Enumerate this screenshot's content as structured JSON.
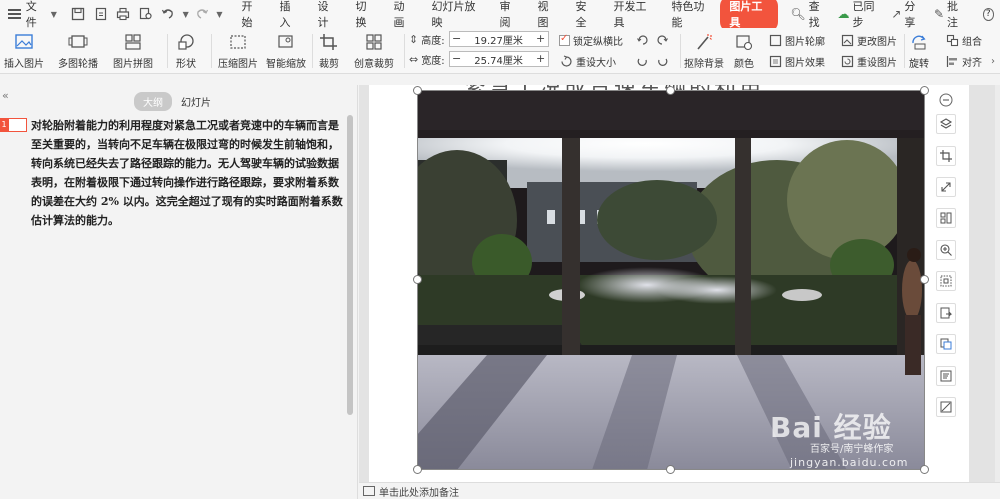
{
  "menubar": {
    "file": "文件",
    "tabs": [
      "开始",
      "插入",
      "设计",
      "切换",
      "动画",
      "幻灯片放映",
      "审阅",
      "视图",
      "安全",
      "开发工具",
      "特色功能"
    ],
    "active_tab": "图片工具",
    "search": "查找",
    "sync": "已同步",
    "share": "分享",
    "comment": "批注",
    "help": "?"
  },
  "ribbon": {
    "insert_picture": "插入图片",
    "multi_carousel": "多图轮播",
    "picture_collage": "图片拼图",
    "shape": "形状",
    "compress": "压缩图片",
    "smart_zoom": "智能缩放",
    "crop": "裁剪",
    "creative_crop": "创意裁剪",
    "height_label": "高度:",
    "height_value": "19.27厘米",
    "width_label": "宽度:",
    "width_value": "25.74厘米",
    "lock_ratio": "锁定纵横比",
    "reset_size": "重设大小",
    "remove_bg": "抠除背景",
    "color": "颜色",
    "outline": "图片轮廓",
    "effect": "图片效果",
    "change_picture": "更改图片",
    "reset_picture": "重设图片",
    "rotate": "旋转",
    "group": "组合",
    "align": "对齐"
  },
  "panel": {
    "collapse": "«",
    "tab_outline": "大纲",
    "tab_slides": "幻灯片",
    "slide_number": "1",
    "outline_text": "对轮胎附着能力的利用程度对紧急工况或者竞速中的车辆而言是至关重要的，当转向不足车辆在极限过弯的时候发生前轴饱和，转向系统已经失去了路径跟踪的能力。无人驾驶车辆的试验数据表明，在附着极限下通过转向操作进行路径跟踪，要求附着系数的误差在大约 2% 以内。这完全超过了现有的实时路面附着系数估计算法的能力。"
  },
  "slide": {
    "title": "紧急工况或竞速车辆的利用"
  },
  "notes": {
    "placeholder": "单击此处添加备注"
  },
  "watermark": {
    "brand": "Bai 经验",
    "sub": "百家号/南宁蜂作家",
    "url": "jingyan.baidu.com"
  },
  "colors": {
    "accent": "#f2543d"
  }
}
